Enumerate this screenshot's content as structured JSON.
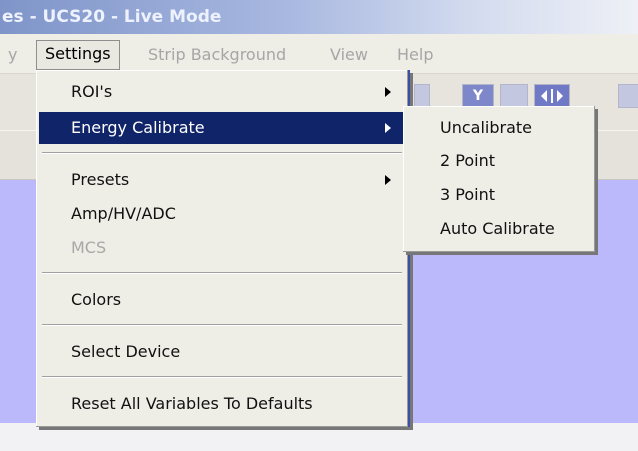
{
  "window": {
    "title": "es - UCS20 - Live Mode"
  },
  "menubar": {
    "partial_left": "y",
    "items": [
      "Settings",
      "Strip Background",
      "View",
      "Help"
    ]
  },
  "toolbar": {
    "y_label": "Y"
  },
  "settings_menu": {
    "items": [
      {
        "label": "ROI's",
        "submenu": true
      },
      {
        "label": "Energy Calibrate",
        "submenu": true,
        "highlighted": true
      },
      {
        "label": "Presets",
        "submenu": true
      },
      {
        "label": "Amp/HV/ADC"
      },
      {
        "label": "MCS",
        "disabled": true
      },
      {
        "label": "Colors"
      },
      {
        "label": "Select Device"
      },
      {
        "label": "Reset All Variables To Defaults"
      }
    ]
  },
  "calibrate_menu": {
    "items": [
      "Uncalibrate",
      "2 Point",
      "3 Point",
      "Auto Calibrate"
    ]
  },
  "colors": {
    "highlight": "#10246a",
    "plot_background": "#bbb8fb",
    "menu_background": "#eeede6"
  }
}
